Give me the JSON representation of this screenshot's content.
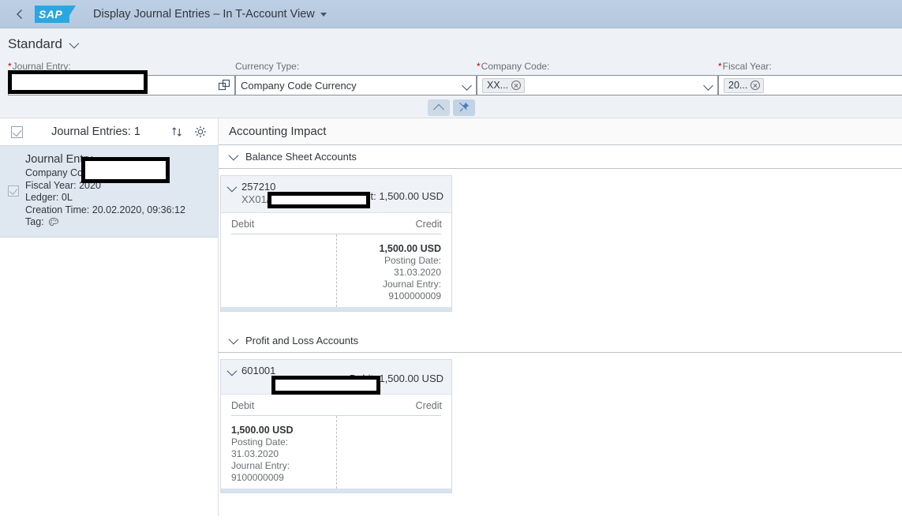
{
  "shell": {
    "back_icon": "back-arrow-icon",
    "logo_text": "SAP",
    "app_title": "Display Journal Entries – In T-Account View",
    "title_caret_icon": "caret-down-icon"
  },
  "filter_bar": {
    "variant_name": "Standard",
    "variant_chevron_icon": "chevron-down-icon",
    "fields": [
      {
        "label": "Journal Entry:",
        "required": true,
        "value": "",
        "placeholder": "",
        "icon": "value-help-icon",
        "redacted": true
      },
      {
        "label": "Currency Type:",
        "required": false,
        "value": "Company Code Currency",
        "icon": "dropdown-arrow-icon"
      },
      {
        "label": "Company Code:",
        "required": true,
        "token": "XX...",
        "token_remove_icon": "token-remove-icon",
        "icon": "dropdown-arrow-icon"
      },
      {
        "label": "Fiscal Year:",
        "required": true,
        "token": "20...",
        "token_remove_icon": "token-remove-icon"
      }
    ],
    "actions": {
      "collapse_icon": "chevron-up-icon",
      "pin_icon": "pin-icon",
      "pin_pressed": true
    }
  },
  "left_pane": {
    "select_all_icon": "checkbox-checked-icon",
    "header_title": "Journal Entries: 1",
    "sort_icon": "sort-icon",
    "settings_icon": "gear-icon",
    "items": [
      {
        "selected": true,
        "checkbox_icon": "checkbox-checked-icon",
        "line1": "Journal Entry",
        "line2": "Company Code",
        "line3": "Fiscal Year: 2020",
        "line4": "Ledger: 0L",
        "line5": "Creation Time: 20.02.2020, 09:36:12",
        "tag_label": "Tag:",
        "tag_icon": "palette-icon",
        "redacted": true
      }
    ]
  },
  "main": {
    "section_title": "Accounting Impact",
    "groups": [
      {
        "label": "Balance Sheet Accounts",
        "chevron_icon": "chevron-down-icon",
        "accounts": [
          {
            "chevron_icon": "chevron-down-icon",
            "account": "257210",
            "description_redacted": true,
            "sub": "XX01/0L/2020",
            "summary": "Credit: 1,500.00 USD",
            "columns": {
              "debit": "Debit",
              "credit": "Credit"
            },
            "entries": [
              {
                "side": "credit",
                "amount": "1,500.00 USD",
                "posting_date_label": "Posting Date:",
                "posting_date": "31.03.2020",
                "journal_entry_label": "Journal Entry:",
                "journal_entry": "9100000009"
              }
            ]
          }
        ]
      },
      {
        "label": "Profit and Loss Accounts",
        "chevron_icon": "chevron-down-icon",
        "accounts": [
          {
            "chevron_icon": "chevron-down-icon",
            "account": "601001",
            "description_redacted": true,
            "sub": "",
            "summary": "Debit: 1,500.00 USD",
            "columns": {
              "debit": "Debit",
              "credit": "Credit"
            },
            "entries": [
              {
                "side": "debit",
                "amount": "1,500.00 USD",
                "posting_date_label": "Posting Date:",
                "posting_date": "31.03.2020",
                "journal_entry_label": "Journal Entry:",
                "journal_entry": "9100000009"
              }
            ]
          }
        ]
      }
    ]
  },
  "colors": {
    "shell_header": "#b5c8de",
    "sap_blue": "#2aa7e0",
    "filter_bar_bg": "#eef2f6",
    "selected_item_bg": "#dfe7f0",
    "required_star": "#bb0000",
    "text": "#32363a",
    "label_text": "#6a6d70"
  }
}
